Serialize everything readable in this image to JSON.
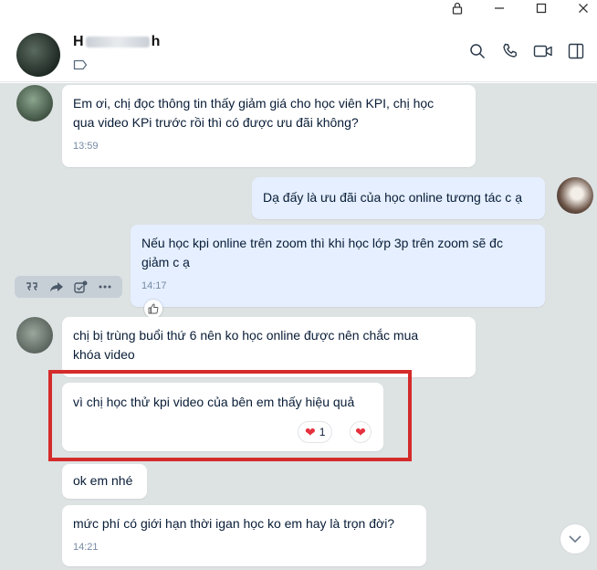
{
  "contact": {
    "name_prefix": "H",
    "name_suffix": "h",
    "avatar": "contact-avatar"
  },
  "window": {
    "icons": [
      "lock-icon",
      "minimize-icon",
      "maximize-icon",
      "close-icon"
    ]
  },
  "header_icons": [
    "search-icon",
    "phone-icon",
    "video-call-icon",
    "sidebar-toggle-icon"
  ],
  "messages": [
    {
      "id": "m1",
      "from": "them",
      "lines": [
        "Em ơi, chị đọc thông tin thấy giảm giá cho học viên KPI, chị học",
        "qua video KPi trước rồi thì có được ưu đãi không?"
      ],
      "time": "13:59"
    },
    {
      "id": "m2",
      "from": "me",
      "lines": [
        "Dạ đấy là ưu đãi của học online tương tác c ạ"
      ]
    },
    {
      "id": "m3",
      "from": "me",
      "lines": [
        "Nếu học kpi online trên zoom thì khi học lớp 3p trên zoom sẽ đc",
        "giảm c ạ"
      ],
      "time": "14:17"
    },
    {
      "id": "m4",
      "from": "them",
      "lines": [
        "chị bị trùng buổi thứ 6 nên ko học online được nên chắc mua",
        "khóa video"
      ]
    },
    {
      "id": "m5",
      "from": "them",
      "lines": [
        "vì chị học thử kpi video của bên em thấy hiệu quả"
      ],
      "reaction_count": "1"
    },
    {
      "id": "m6",
      "from": "them",
      "lines": [
        "ok em nhé"
      ]
    },
    {
      "id": "m7",
      "from": "them",
      "lines": [
        "mức phí có giới hạn thời igan học ko em hay là trọn đời?"
      ],
      "time": "14:21"
    }
  ],
  "hover_actions": [
    "quote-icon",
    "forward-icon",
    "add-task-icon",
    "more-icon"
  ],
  "colors": {
    "chat_bg": "#dde2e3",
    "my_bubble": "#e5efff",
    "their_bubble": "#ffffff",
    "highlight": "#d42b2b",
    "heart": "#e5303d"
  }
}
